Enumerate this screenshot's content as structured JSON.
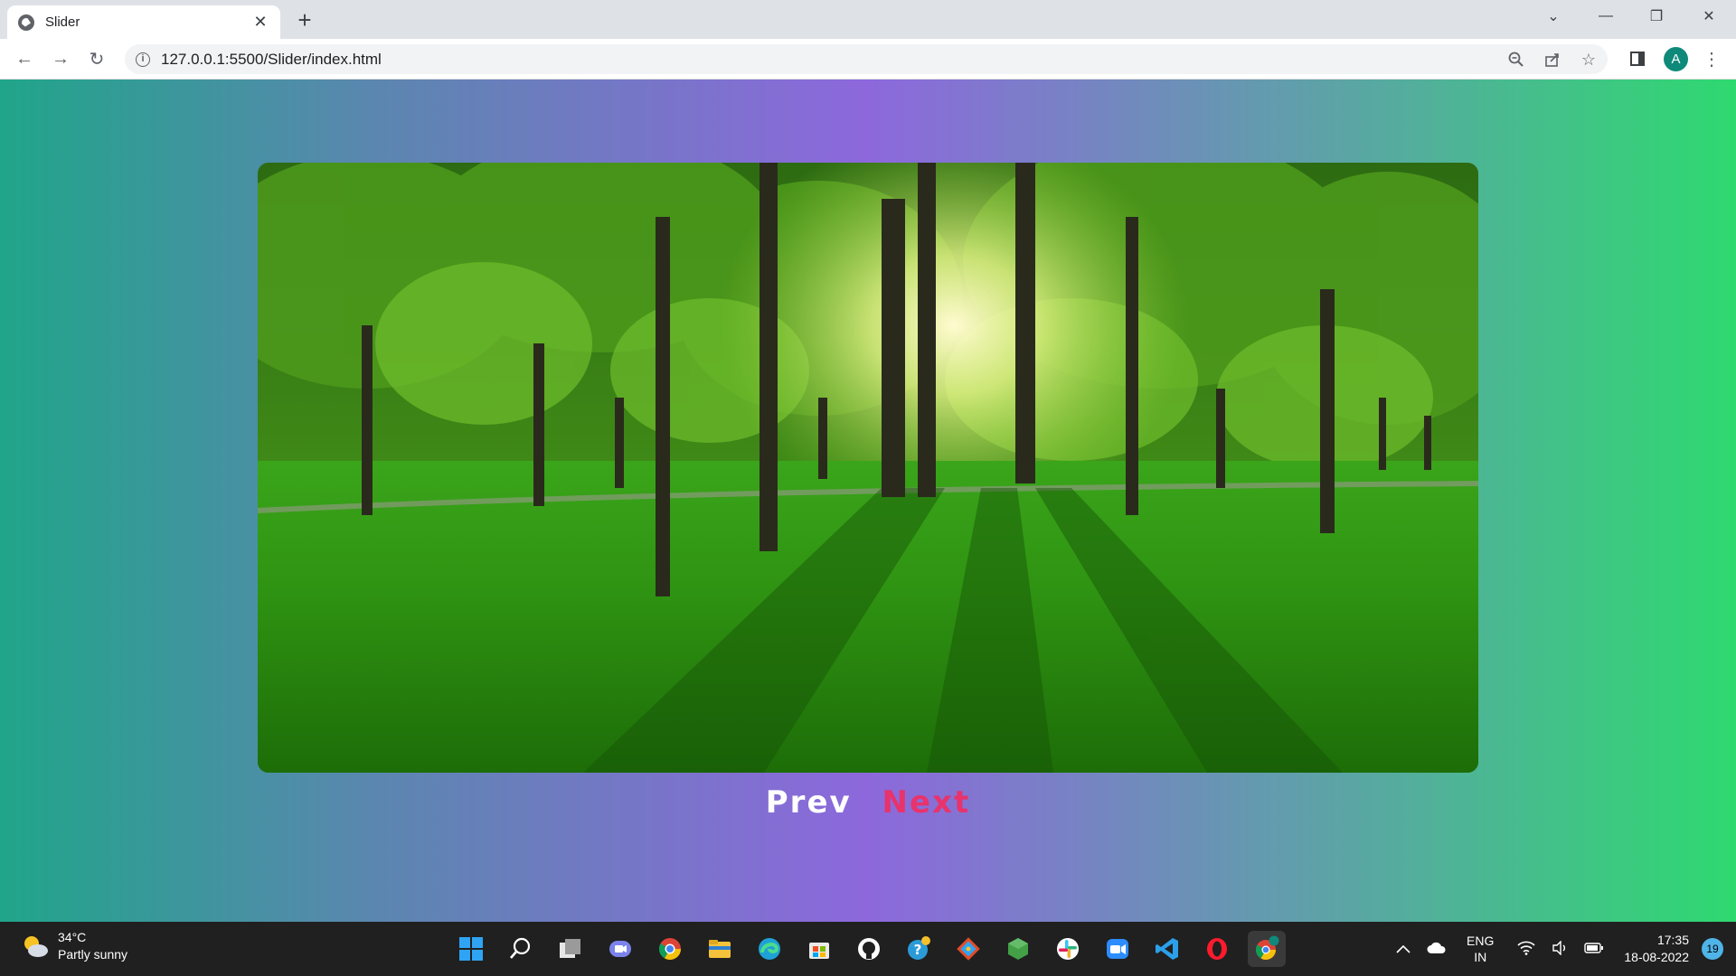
{
  "browser": {
    "tab_title": "Slider",
    "url": "127.0.0.1:5500/Slider/index.html",
    "profile_initial": "A"
  },
  "slider": {
    "prev_label": "Prev",
    "next_label": "Next",
    "next_color": "#e8336c"
  },
  "taskbar": {
    "weather_temp": "34°C",
    "weather_desc": "Partly sunny",
    "lang_line1": "ENG",
    "lang_line2": "IN",
    "time": "17:35",
    "date": "18-08-2022",
    "notification_count": "19",
    "apps": [
      "start-icon",
      "search-icon",
      "task-view-icon",
      "teams-chat-icon",
      "chrome-icon",
      "file-explorer-icon",
      "edge-icon",
      "store-icon",
      "github-icon",
      "help-icon",
      "git-icon",
      "nodejs-icon",
      "slack-icon",
      "zoom-icon",
      "vscode-icon",
      "opera-icon",
      "chrome-profile-icon"
    ]
  }
}
